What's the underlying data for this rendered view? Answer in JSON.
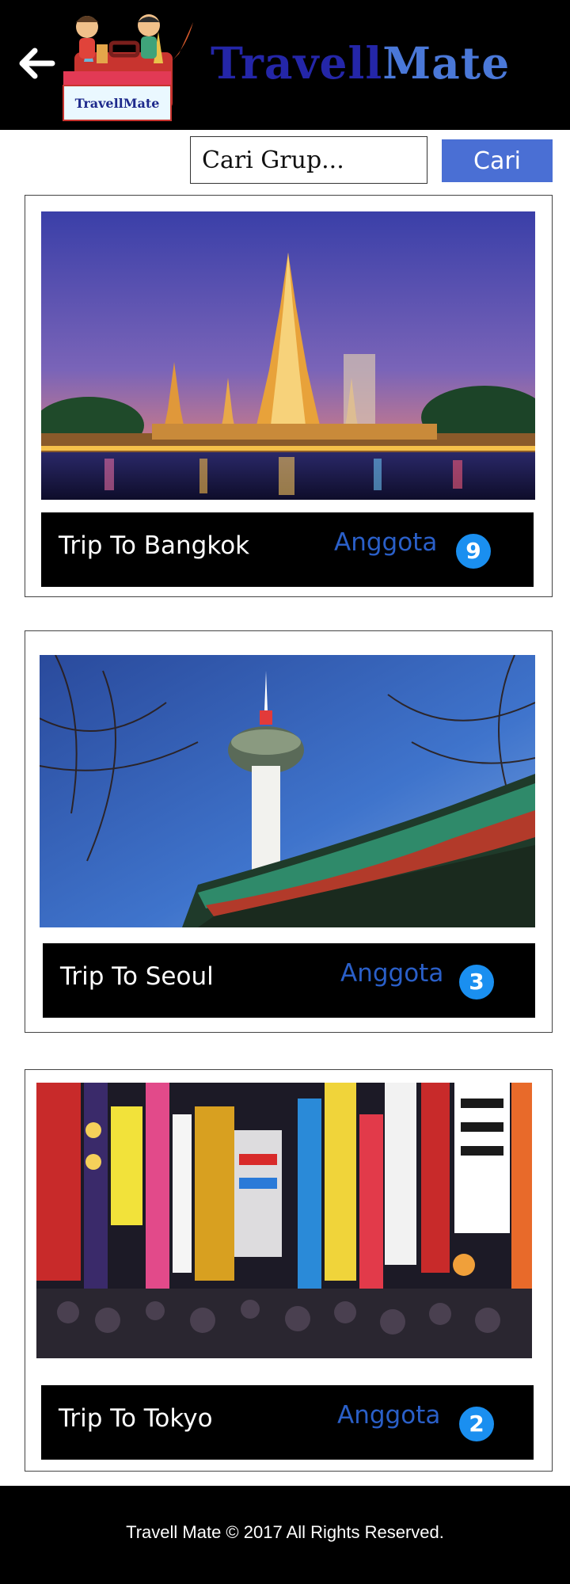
{
  "app": {
    "brand_part1": "Travell",
    "brand_part2": "Mate",
    "logo_text": "TravellMate",
    "back_icon": "arrow-left-icon"
  },
  "search": {
    "placeholder": "Cari Grup...",
    "button_label": "Cari"
  },
  "groups": [
    {
      "title": "Trip To Bangkok",
      "member_label": "Anggota",
      "member_count": "9",
      "image": "bangkok-temple-night"
    },
    {
      "title": "Trip To Seoul",
      "member_label": "Anggota",
      "member_count": "3",
      "image": "seoul-tower-blue-sky"
    },
    {
      "title": "Trip To Tokyo",
      "member_label": "Anggota",
      "member_count": "2",
      "image": "tokyo-neon-street"
    }
  ],
  "footer": {
    "text": "Travell Mate © 2017 All Rights Reserved."
  },
  "colors": {
    "header_bg": "#000000",
    "brand_dark": "#2426a8",
    "brand_light": "#4a78d8",
    "button_bg": "#4a6fd4",
    "anggota_text": "#2a5fc8",
    "badge_bg": "#1a8ff0"
  }
}
